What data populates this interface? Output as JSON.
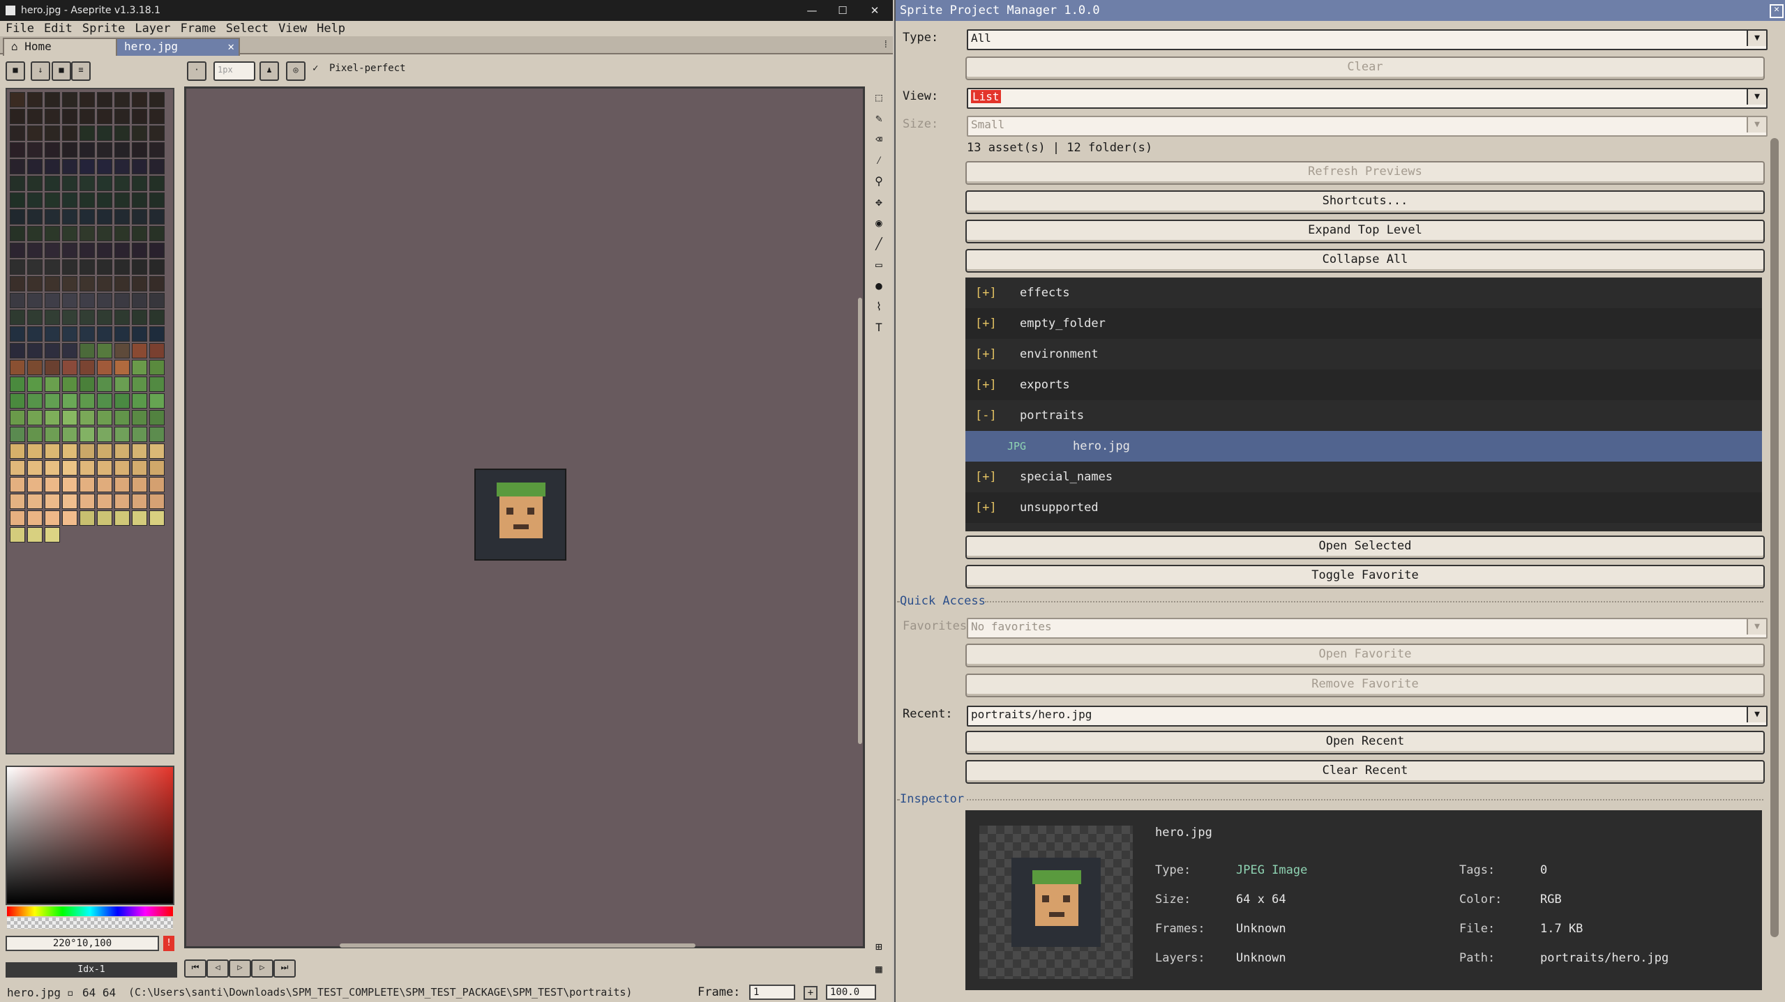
{
  "aseprite": {
    "window_title": "hero.jpg - Aseprite v1.3.18.1",
    "window_controls": {
      "minimize": "—",
      "maximize": "☐",
      "close": "✕"
    },
    "menu": [
      "File",
      "Edit",
      "Sprite",
      "Layer",
      "Frame",
      "Select",
      "View",
      "Help"
    ],
    "tabs": [
      {
        "label": "Home",
        "icon": "home-icon"
      },
      {
        "label": "hero.jpg"
      }
    ],
    "toolbar": {
      "brush_size": "1px",
      "pixel_perfect_label": "Pixel-perfect"
    },
    "color_value": "220°10,100",
    "palette_index": "Idx-1",
    "status": {
      "file": "hero.jpg",
      "size": "64 64",
      "path": "(C:\\Users\\santi\\Downloads\\SPM_TEST_COMPLETE\\SPM_TEST_PACKAGE\\SPM_TEST\\portraits)",
      "frame_label": "Frame:",
      "frame_value": "1",
      "zoom": "100.0"
    }
  },
  "spm": {
    "title": "Sprite Project Manager 1.0.0",
    "type_label": "Type:",
    "type_value": "All",
    "clear_label": "Clear",
    "view_label": "View:",
    "view_value": "List",
    "size_label": "Size:",
    "size_value": "Small",
    "counts": "13 asset(s)  |  12 folder(s)",
    "buttons": {
      "refresh": "Refresh Previews",
      "shortcuts": "Shortcuts...",
      "expand": "Expand Top Level",
      "collapse": "Collapse All",
      "open_selected": "Open Selected",
      "toggle_favorite": "Toggle Favorite",
      "open_favorite": "Open Favorite",
      "remove_favorite": "Remove Favorite",
      "open_recent": "Open Recent",
      "clear_recent": "Clear Recent"
    },
    "tree": [
      {
        "toggle": "[+]",
        "name": "effects"
      },
      {
        "toggle": "[+]",
        "name": "empty_folder"
      },
      {
        "toggle": "[+]",
        "name": "environment"
      },
      {
        "toggle": "[+]",
        "name": "exports"
      },
      {
        "toggle": "[-]",
        "name": "portraits"
      },
      {
        "toggle": "JPG",
        "name": "hero.jpg",
        "selected": true
      },
      {
        "toggle": "[+]",
        "name": "special_names"
      },
      {
        "toggle": "[+]",
        "name": "unsupported"
      }
    ],
    "quick_access_label": "Quick Access",
    "favorites_label": "Favorites:",
    "favorites_value": "No favorites",
    "recent_label": "Recent:",
    "recent_value": "portraits/hero.jpg",
    "inspector_label": "Inspector",
    "inspector": {
      "filename": "hero.jpg",
      "type_key": "Type:",
      "type_val": "JPEG Image",
      "size_key": "Size:",
      "size_val": "64 x 64",
      "frames_key": "Frames:",
      "frames_val": "Unknown",
      "layers_key": "Layers:",
      "layers_val": "Unknown",
      "tags_key": "Tags:",
      "tags_val": "0",
      "color_key": "Color:",
      "color_val": "RGB",
      "file_key": "File:",
      "file_val": "1.7 KB",
      "path_key": "Path:",
      "path_val": "portraits/hero.jpg"
    }
  },
  "colors": {
    "accent": "#6e7fa8",
    "tree_selected": "#51648f",
    "panel_bg": "#d3cbbd",
    "dark_panel": "#2c2c2c",
    "canvas_bg": "#685a5e"
  }
}
